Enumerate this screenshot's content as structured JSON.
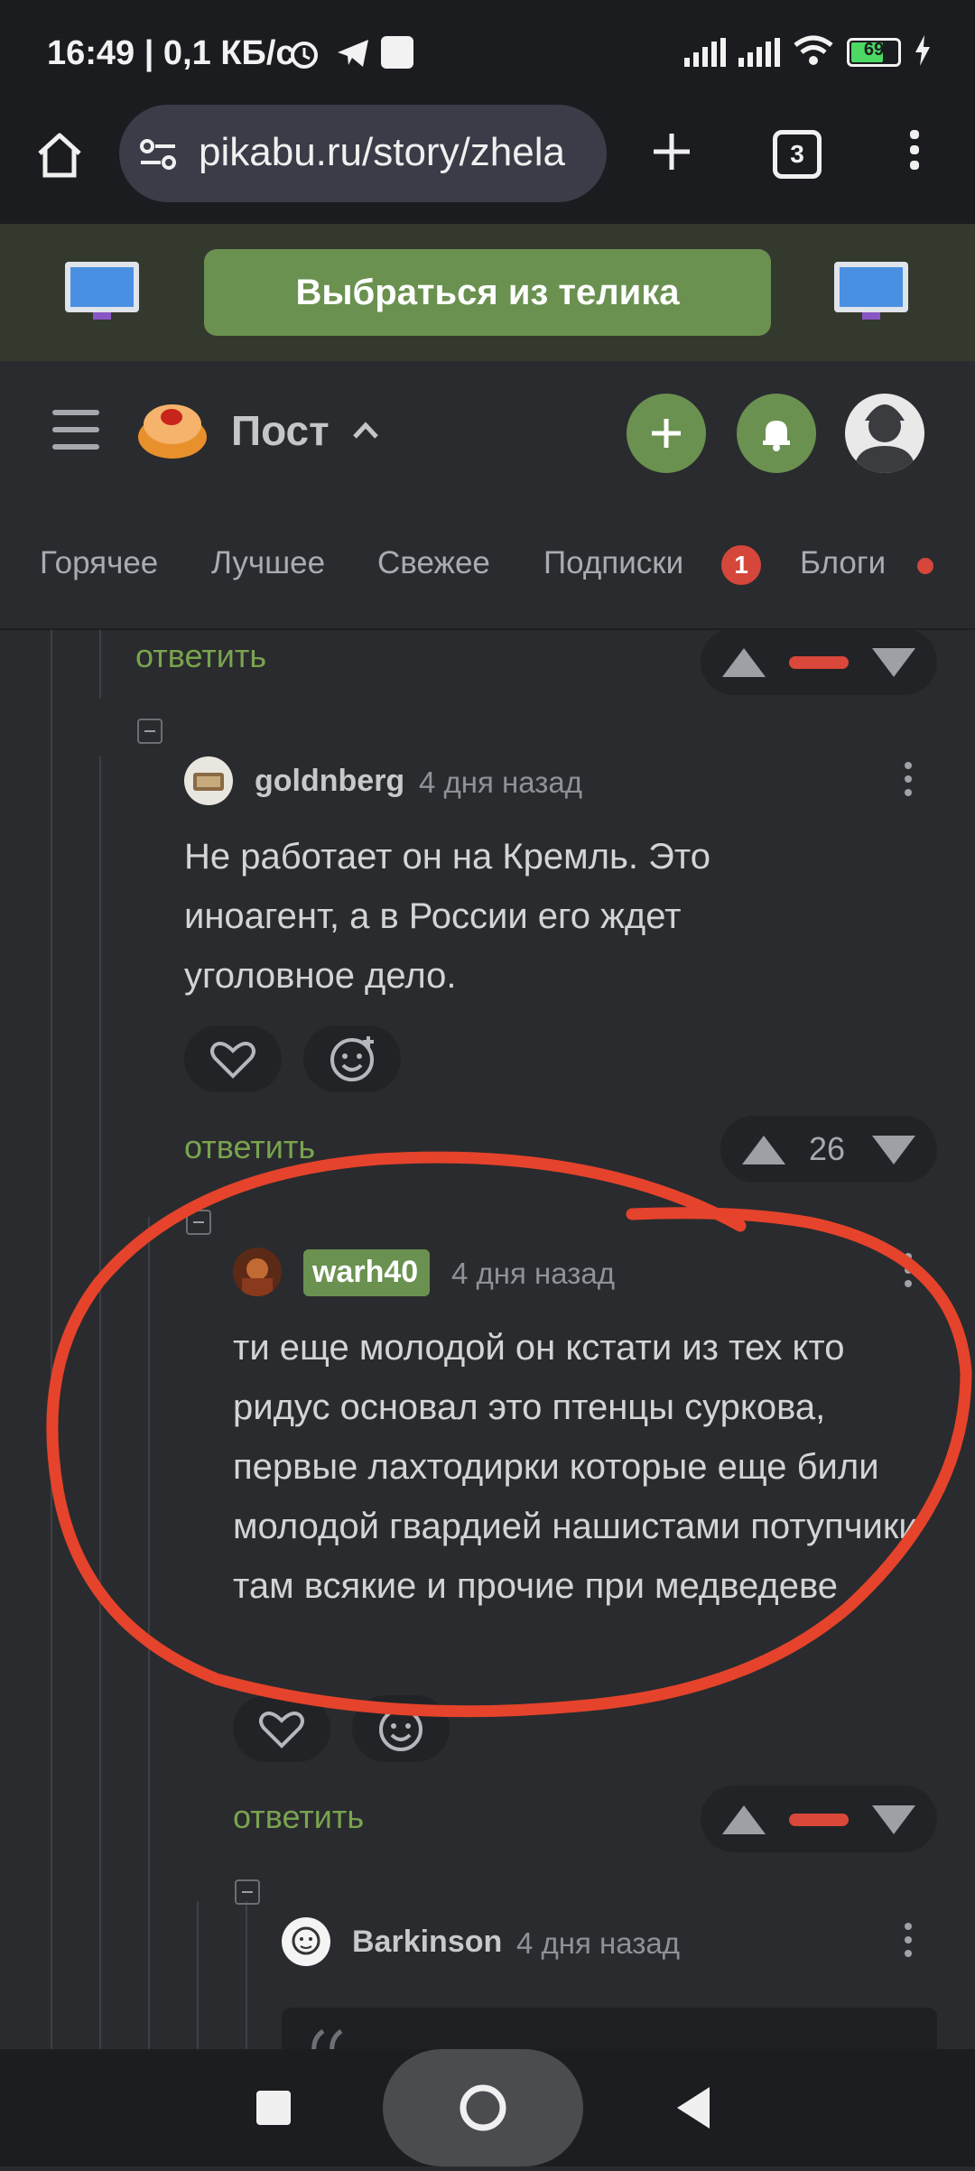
{
  "status_bar": {
    "time": "16:49 | 0,1 КБ/с",
    "battery": "69",
    "battery_level": 0.69
  },
  "browser": {
    "url": "pikabu.ru/story/zhela",
    "tab_count": "3"
  },
  "promo": {
    "button_label": "Выбраться из телика"
  },
  "header": {
    "title": "Пост"
  },
  "tabs": [
    {
      "label": "Горячее"
    },
    {
      "label": "Лучшее"
    },
    {
      "label": "Свежее"
    },
    {
      "label": "Подписки",
      "badge": "1"
    },
    {
      "label": "Блоги"
    }
  ],
  "comments": {
    "reply_label": "ответить",
    "top_reply": {
      "reply": "ответить"
    },
    "goldnberg": {
      "username": "goldnberg",
      "time": "4 дня назад",
      "text": "Не работает он на Кремль. Это иноагент, а в России его ждет уголовное дело.",
      "rating": "26",
      "reply": "ответить"
    },
    "warh40": {
      "username": "warh40",
      "time": "4 дня назад",
      "text": "ти еще молодой он кстати из тех кто ридус основал это птенцы суркова, первые лахтодирки которые еще били молодой гвардией нашистами потупчики там всякие и прочие при медведеве",
      "reply": "ответить"
    },
    "barkinson": {
      "username": "Barkinson",
      "time": "4 дня назад"
    }
  },
  "colors": {
    "accent_green": "#6a9150",
    "link_green": "#79a44f",
    "badge_red": "#d5473a",
    "annotation_red": "#e5432b"
  }
}
